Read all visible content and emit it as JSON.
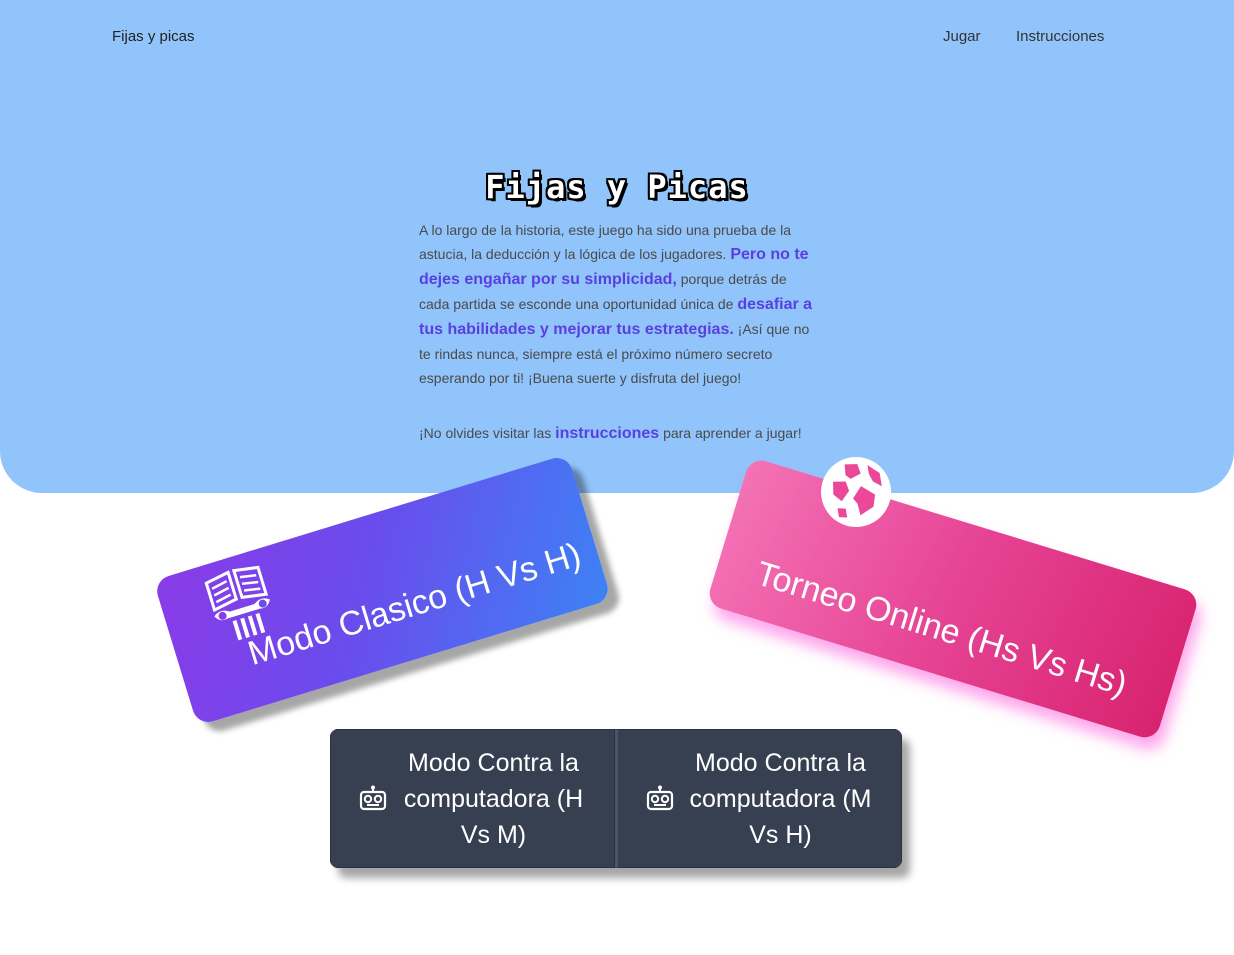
{
  "nav": {
    "brand": "Fijas y picas",
    "links": [
      "Jugar",
      "Instrucciones"
    ]
  },
  "hero": {
    "title": "Fijas y Picas",
    "intro": {
      "p1": "A lo largo de la historia, este juego ha sido una prueba de la astucia, la deducción y la lógica de los jugadores. ",
      "h1": "Pero no te dejes engañar por su simplicidad,",
      "p2": " porque detrás de cada partida se esconde una oportunidad única de ",
      "h2": "desafiar a tus habilidades y mejorar tus estrategias.",
      "p3": " ¡Así que no te rindas nunca, siempre está el próximo número secreto esperando por ti! ¡Buena suerte y disfruta del juego!"
    },
    "reminder": {
      "before": "¡No olvides visitar las ",
      "link": "instrucciones",
      "after": " para aprender a jugar!"
    }
  },
  "modes": {
    "classic": {
      "label": "Modo Clasico (H Vs H)",
      "icon": "book-column-icon"
    },
    "online": {
      "label": "Torneo Online (Hs Vs Hs)",
      "icon": "globe-icon"
    },
    "vs_human_machine": {
      "label": "Modo Contra la computadora (H Vs M)",
      "icon": "robot-icon"
    },
    "vs_machine_human": {
      "label": "Modo Contra la computadora (M Vs H)",
      "icon": "robot-icon"
    }
  },
  "colors": {
    "hero_bg": "#91c4fb",
    "highlight": "#5a3fe0",
    "classic_gradient": [
      "#8a3be8",
      "#3d82f5"
    ],
    "online_gradient": [
      "#f472b6",
      "#d8236f"
    ],
    "vs_bg": "#374050"
  }
}
